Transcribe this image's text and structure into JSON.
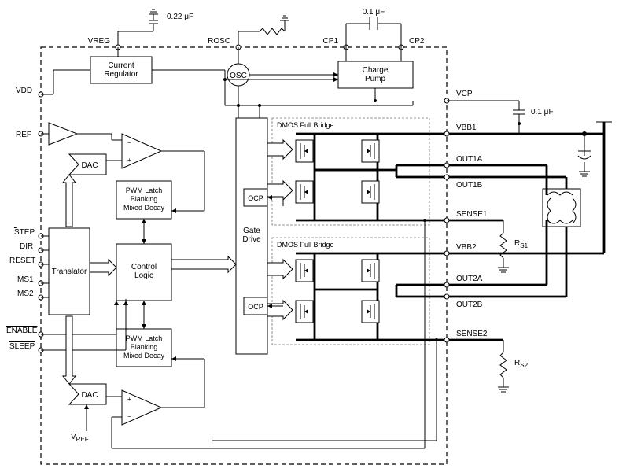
{
  "external": {
    "cap_vreg": "0.22 μF",
    "cap_cp": "0.1 μF",
    "cap_vcp": "0.1 μF",
    "rs1": "R",
    "rs1_sub": "S1",
    "rs2": "R",
    "rs2_sub": "S2"
  },
  "pins": {
    "vreg": "VREG",
    "rosc": "ROSC",
    "cp1": "CP1",
    "cp2": "CP2",
    "vcp": "VCP",
    "vdd": "VDD",
    "ref": "REF",
    "step": "STEP",
    "dir": "DIR",
    "reset": "RESET",
    "ms1": "MS1",
    "ms2": "MS2",
    "enable": "ENABLE",
    "sleep": "SLEEP",
    "vref": "V",
    "vref_sub": "REF",
    "vbb1": "VBB1",
    "out1a": "OUT1A",
    "out1b": "OUT1B",
    "sense1": "SENSE1",
    "vbb2": "VBB2",
    "out2a": "OUT2A",
    "out2b": "OUT2B",
    "sense2": "SENSE2"
  },
  "blocks": {
    "current_reg": "Current\nRegulator",
    "osc": "OSC",
    "charge_pump": "Charge\nPump",
    "dac1": "DAC",
    "dac2": "DAC",
    "pwm1": "PWM Latch\nBlanking\nMixed Decay",
    "pwm2": "PWM Latch\nBlanking\nMixed Decay",
    "translator": "Translator",
    "control": "Control\nLogic",
    "gate_drive": "Gate\nDrive",
    "ocp1": "OCP",
    "ocp2": "OCP",
    "bridge_title": "DMOS Full Bridge"
  },
  "op_signs": {
    "plus": "+",
    "minus": "−"
  }
}
